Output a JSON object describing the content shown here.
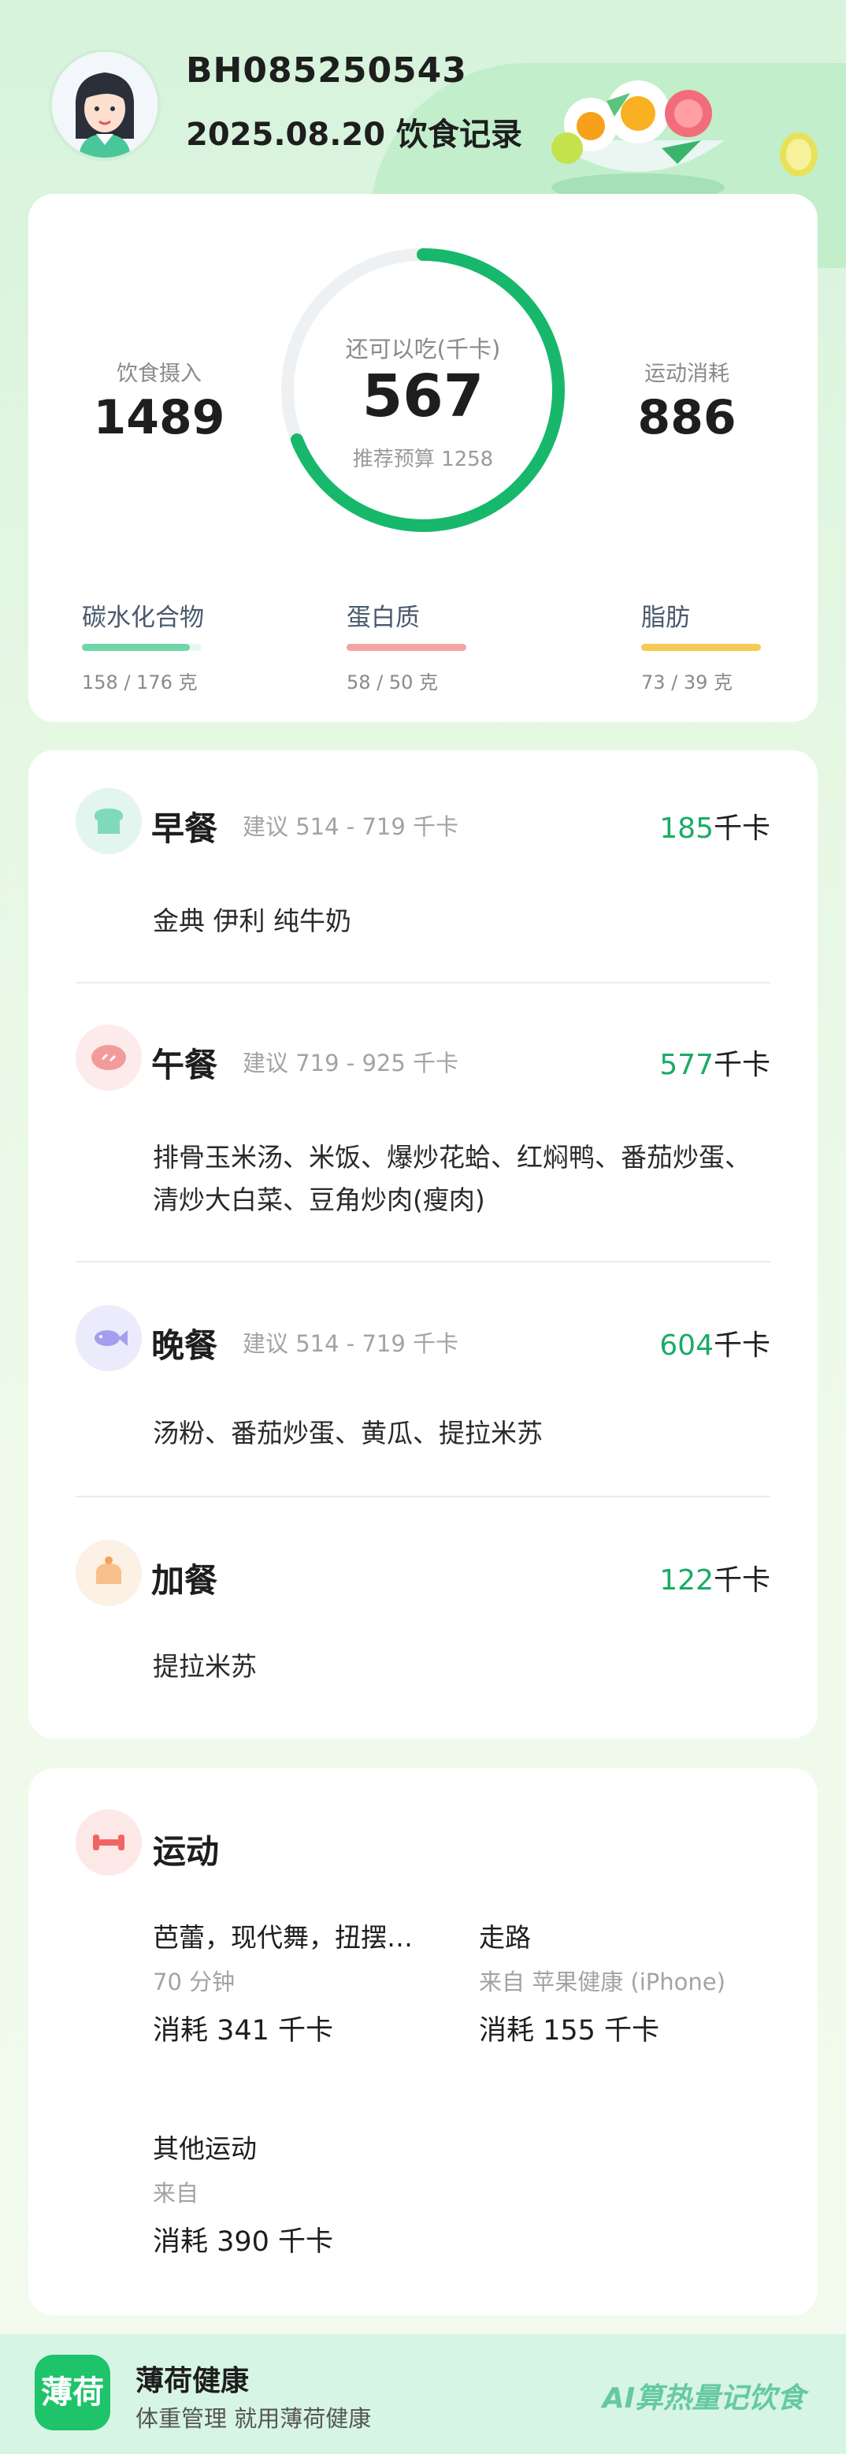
{
  "header": {
    "user_id": "BH085250543",
    "record_title": "2025.08.20 饮食记录"
  },
  "summary": {
    "intake_label": "饮食摄入",
    "intake_value": "1489",
    "remaining_label": "还可以吃(千卡)",
    "remaining_value": "567",
    "budget_label": "推荐预算 1258",
    "exercise_label": "运动消耗",
    "exercise_value": "886",
    "ring_progress": 0.69,
    "macros": [
      {
        "name": "碳水化合物",
        "amount": "158 / 176 克",
        "progress": 0.9,
        "color": "#6fd6a8"
      },
      {
        "name": "蛋白质",
        "amount": "58 / 50 克",
        "progress": 1.0,
        "color": "#f6a3a3"
      },
      {
        "name": "脂肪",
        "amount": "73 / 39 克",
        "progress": 1.0,
        "color": "#f5cb52"
      }
    ]
  },
  "meals": [
    {
      "name": "早餐",
      "suggest": "建议 514 - 719 千卡",
      "kcal": "185",
      "unit": "千卡",
      "foods": "金典 伊利 纯牛奶",
      "icon": "bread-icon",
      "icon_bg": "#e2f6ef"
    },
    {
      "name": "午餐",
      "suggest": "建议 719 - 925 千卡",
      "kcal": "577",
      "unit": "千卡",
      "foods": "排骨玉米汤、米饭、爆炒花蛤、红焖鸭、番茄炒蛋、清炒大白菜、豆角炒肉(瘦肉)",
      "icon": "meat-icon",
      "icon_bg": "#fdebeb"
    },
    {
      "name": "晚餐",
      "suggest": "建议 514 - 719 千卡",
      "kcal": "604",
      "unit": "千卡",
      "foods": "汤粉、番茄炒蛋、黄瓜、提拉米苏",
      "icon": "fish-icon",
      "icon_bg": "#ecebfb"
    },
    {
      "name": "加餐",
      "suggest": "",
      "kcal": "122",
      "unit": "千卡",
      "foods": "提拉米苏",
      "icon": "cake-icon",
      "icon_bg": "#fdf0e4"
    }
  ],
  "sport": {
    "title": "运动",
    "items": [
      {
        "name": "芭蕾，现代舞，扭摆…",
        "meta": "70 分钟",
        "burn": "消耗 341 千卡"
      },
      {
        "name": "走路",
        "meta": "来自 苹果健康 (iPhone)",
        "burn": "消耗 155 千卡"
      },
      {
        "name": "其他运动",
        "meta": "来自",
        "burn": "消耗 390 千卡"
      }
    ]
  },
  "footer": {
    "logo_text": "薄荷",
    "app_name": "薄荷健康",
    "slogan": "体重管理 就用薄荷健康",
    "tagline": "AI算热量记饮食"
  },
  "colors": {
    "accent": "#1aab67",
    "ring": "#17b86c",
    "ring_track": "#eef1f3"
  }
}
